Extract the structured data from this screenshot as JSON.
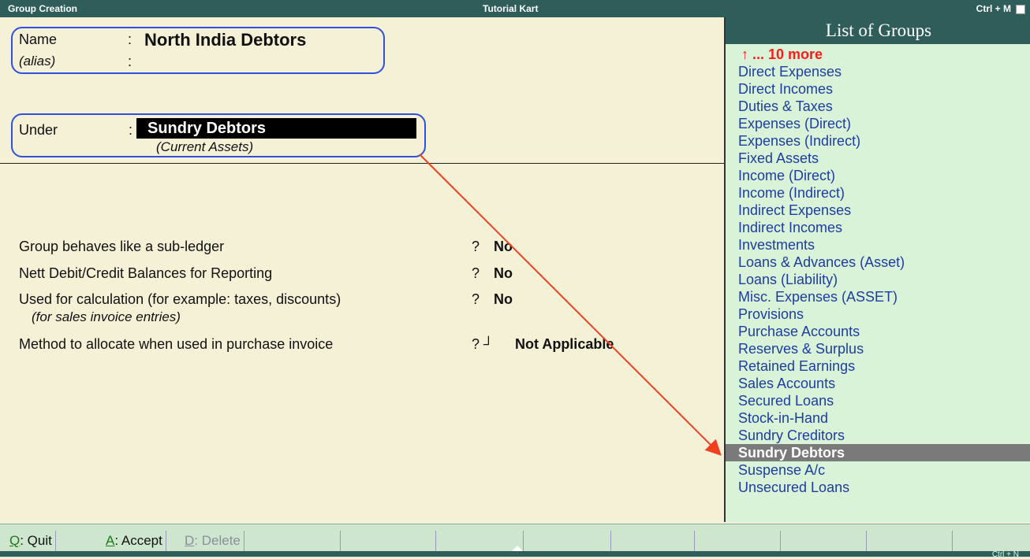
{
  "titlebar": {
    "left": "Group Creation",
    "center": "Tutorial Kart",
    "right": "Ctrl + M"
  },
  "form": {
    "name_label": "Name",
    "colon": ":",
    "name_value": "North India Debtors",
    "alias_label": "(alias)",
    "under_label": "Under",
    "under_value": "Sundry Debtors",
    "under_sub": "(Current Assets)"
  },
  "questions": [
    {
      "label": "Group behaves like a sub-ledger",
      "mark": "?",
      "value": "No"
    },
    {
      "label": "Nett Debit/Credit Balances for Reporting",
      "mark": "?",
      "value": "No"
    },
    {
      "label": "Used for calculation (for example: taxes, discounts)",
      "sub": "(for sales invoice entries)",
      "mark": "?",
      "value": "No"
    },
    {
      "label": "Method to allocate when used in purchase invoice",
      "mark": "? ┘",
      "value": "Not Applicable"
    }
  ],
  "list": {
    "title": "List of Groups",
    "more": "↑ ... 10 more",
    "items": [
      "Direct Expenses",
      "Direct Incomes",
      "Duties & Taxes",
      "Expenses (Direct)",
      "Expenses (Indirect)",
      "Fixed Assets",
      "Income (Direct)",
      "Income (Indirect)",
      "Indirect Expenses",
      "Indirect Incomes",
      "Investments",
      "Loans & Advances (Asset)",
      "Loans (Liability)",
      "Misc. Expenses (ASSET)",
      "Provisions",
      "Purchase Accounts",
      "Reserves & Surplus",
      "Retained Earnings",
      "Sales Accounts",
      "Secured Loans",
      "Stock-in-Hand",
      "Sundry Creditors",
      "Sundry Debtors",
      "Suspense A/c",
      "Unsecured Loans"
    ],
    "selected": "Sundry Debtors"
  },
  "buttons": [
    {
      "key": "Q",
      "label": ": Quit",
      "enabled": true
    },
    {
      "key": "A",
      "label": ": Accept",
      "enabled": true
    },
    {
      "key": "D",
      "label": ": Delete",
      "enabled": false
    }
  ],
  "footer_right": "Ctrl + N",
  "colors": {
    "header": "#2f5e5a",
    "panel": "#d8f3d8",
    "annotation": "#3050e0",
    "arrow": "#f04020"
  }
}
